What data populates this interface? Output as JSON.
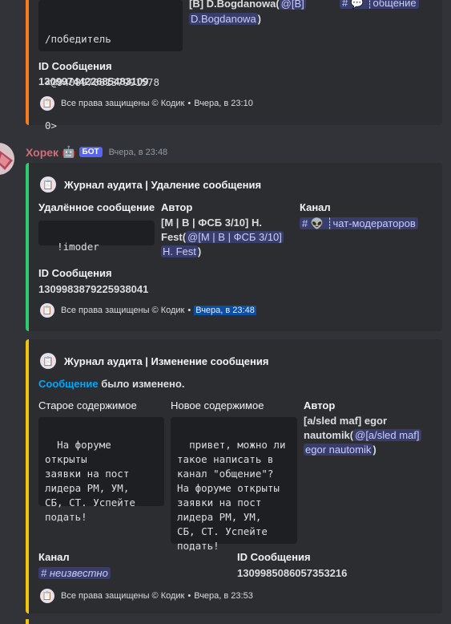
{
  "colors": {
    "background": "#313338",
    "embed_bg": "#2b2d31",
    "accent_orange": "#f57c1f",
    "accent_teal": "#2ecc71",
    "accent_yellow": "#f1c40f",
    "bot_badge": "#5865f2",
    "author_name": "#d16d7a",
    "link": "#00a8fc"
  },
  "embed1": {
    "code_lines": [
      "/победитель",
      "<@94089706137991578",
      "0>"
    ],
    "author_value_line1": "[B] D.Bogdanowa(",
    "author_mention_part1": "@[B]",
    "author_mention_part2": "D.Bogdanowa",
    "author_close": ")",
    "channel_value": "# 💬 ┊общение",
    "id_label": "ID Сообщения",
    "id_value": "1309974422685483109",
    "footer": "Все права защищены © Кодик",
    "footer_sep": "•",
    "footer_time": "Вчера, в 23:10"
  },
  "message": {
    "author": "Хорек",
    "bot_emoji": "🤖",
    "badge": "БОТ",
    "timestamp": "Вчера, в 23:48"
  },
  "embed2": {
    "title": "Журнал аудита | Удаление сообщения",
    "deleted_label": "Удалённое сообщение",
    "deleted_value": "!imoder",
    "author_label": "Автор",
    "author_line1": "[M | B | ФСБ 3/10] H.",
    "author_line2_prefix": "Fest(",
    "author_mention_a": "@[M | B | ФСБ 3/10]",
    "author_mention_b": "H. Fest",
    "author_close": ")",
    "channel_label": "Канал",
    "channel_hash": "#",
    "channel_emoji": "👽",
    "channel_name": "┊чат-модераторов",
    "id_label": "ID Сообщения",
    "id_value": "1309983879225938041",
    "footer": "Все права защищены © Кодик",
    "footer_sep": "•",
    "footer_time": "Вчера, в 23:48"
  },
  "embed3": {
    "title": "Журнал аудита | Изменение сообщения",
    "desc_link": "Сообщение",
    "desc_rest": " было изменено.",
    "old_label": "Старое содержимое",
    "old_value": "На форуме открыты\nзаявки на пост\nлидера РМ, УМ,\nСБ, СТ. Успейте\nподать!",
    "new_label": "Новое содержимое",
    "new_value": "привет, можно ли\nтакое написать в\nканал \"общение\"?\nНа форуме открыты\nзаявки на пост\nлидера РМ, УМ,\nСБ, СТ. Успейте\nподать!",
    "author_label": "Автор",
    "author_line1": "[a/sled maf] egor",
    "author_line2_prefix": "nautomik(",
    "author_mention_a": "@[a/sled maf]",
    "author_mention_b": "egor nautomik",
    "author_close": ")",
    "channel_label": "Канал",
    "channel_value": "# неизвестно",
    "id_label": "ID Сообщения",
    "id_value": "1309985086057353216",
    "footer": "Все права защищены © Кодик",
    "footer_sep": "•",
    "footer_time": "Вчера, в 23:53"
  }
}
